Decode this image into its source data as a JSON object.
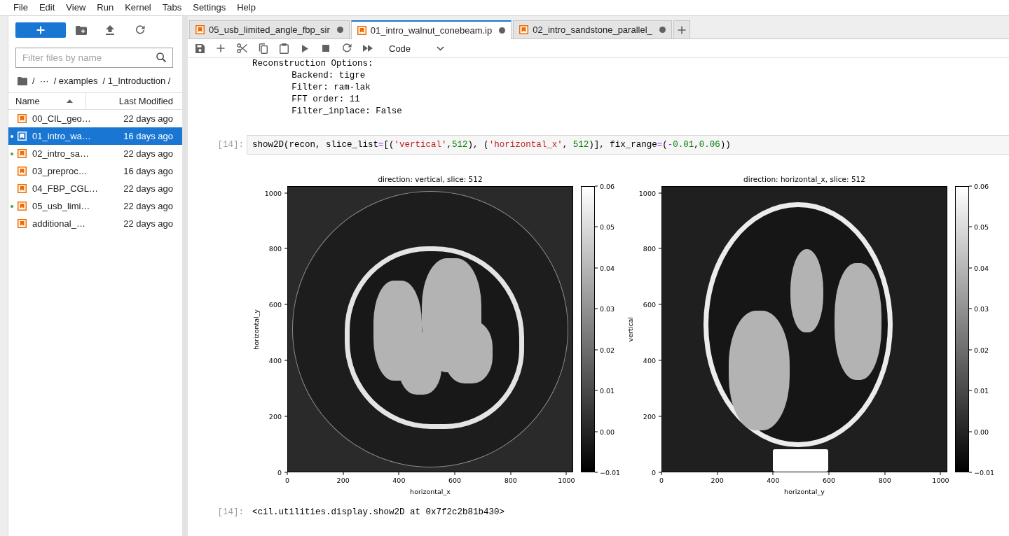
{
  "menu": [
    "File",
    "Edit",
    "View",
    "Run",
    "Kernel",
    "Tabs",
    "Settings",
    "Help"
  ],
  "file_browser": {
    "filter": {
      "placeholder": "Filter files by name"
    },
    "breadcrumbs": [
      "/",
      "···",
      "/ examples",
      "/ 1_Introduction /"
    ],
    "columns": [
      {
        "label": "Name",
        "sorted": true
      },
      {
        "label": "Last Modified",
        "sorted": false
      }
    ],
    "files": [
      {
        "name": "00_CIL_geo…",
        "modified": "22 days ago",
        "selected": false,
        "running": false
      },
      {
        "name": "01_intro_wa…",
        "modified": "16 days ago",
        "selected": true,
        "running": true
      },
      {
        "name": "02_intro_sa…",
        "modified": "22 days ago",
        "selected": false,
        "running": true
      },
      {
        "name": "03_preproc…",
        "modified": "16 days ago",
        "selected": false,
        "running": false
      },
      {
        "name": "04_FBP_CGL…",
        "modified": "22 days ago",
        "selected": false,
        "running": false
      },
      {
        "name": "05_usb_limi…",
        "modified": "22 days ago",
        "selected": false,
        "running": true
      },
      {
        "name": "additional_…",
        "modified": "22 days ago",
        "selected": false,
        "running": false
      }
    ]
  },
  "tabs": [
    {
      "label": "05_usb_limited_angle_fbp_sir",
      "selected": false,
      "unsaved": true
    },
    {
      "label": "01_intro_walnut_conebeam.ip",
      "selected": true,
      "unsaved": true
    },
    {
      "label": "02_intro_sandstone_parallel_",
      "selected": false,
      "unsaved": true
    }
  ],
  "toolbar": {
    "cell_type": "Code"
  },
  "notebook": {
    "stream_output": "Reconstruction Options:\n\tBackend: tigre\n\tFilter: ram-lak\n\tFFT order: 11\n\tFilter_inplace: False",
    "code_cell": {
      "prompt": "[14]:",
      "tokens": [
        {
          "text": "show2D(recon, slice_list",
          "kind": "plain"
        },
        {
          "text": "=",
          "kind": "operator"
        },
        {
          "text": "[(",
          "kind": "plain"
        },
        {
          "text": "'vertical'",
          "kind": "string"
        },
        {
          "text": ",",
          "kind": "plain"
        },
        {
          "text": "512",
          "kind": "number"
        },
        {
          "text": "), (",
          "kind": "plain"
        },
        {
          "text": "'horizontal_x'",
          "kind": "string"
        },
        {
          "text": ", ",
          "kind": "plain"
        },
        {
          "text": "512",
          "kind": "number"
        },
        {
          "text": ")], fix_range",
          "kind": "plain"
        },
        {
          "text": "=",
          "kind": "operator"
        },
        {
          "text": "(",
          "kind": "plain"
        },
        {
          "text": "-",
          "kind": "operator"
        },
        {
          "text": "0.01",
          "kind": "number"
        },
        {
          "text": ",",
          "kind": "plain"
        },
        {
          "text": "0.06",
          "kind": "number"
        },
        {
          "text": "))",
          "kind": "plain"
        }
      ]
    },
    "figures": [
      {
        "title": "direction: vertical, slice: 512",
        "xlabel": "horizontal_x",
        "ylabel": "horizontal_y",
        "xticks": [
          "0",
          "200",
          "400",
          "600",
          "800",
          "1000"
        ],
        "yticks": [
          "1000",
          "800",
          "600",
          "400",
          "200",
          "0"
        ],
        "colorbar_ticks": [
          "0.06",
          "0.05",
          "0.04",
          "0.03",
          "0.02",
          "0.01",
          "0.00",
          "−0.01"
        ]
      },
      {
        "title": "direction: horizontal_x, slice: 512",
        "xlabel": "horizontal_y",
        "ylabel": "vertical",
        "xticks": [
          "0",
          "200",
          "400",
          "600",
          "800",
          "1000"
        ],
        "yticks": [
          "1000",
          "800",
          "600",
          "400",
          "200",
          "0"
        ],
        "colorbar_ticks": [
          "0.06",
          "0.05",
          "0.04",
          "0.03",
          "0.02",
          "0.01",
          "0.00",
          "−0.01"
        ]
      }
    ],
    "result": {
      "prompt": "[14]:",
      "text": "<cil.utilities.display.show2D at 0x7f2c2b81b430>"
    }
  }
}
